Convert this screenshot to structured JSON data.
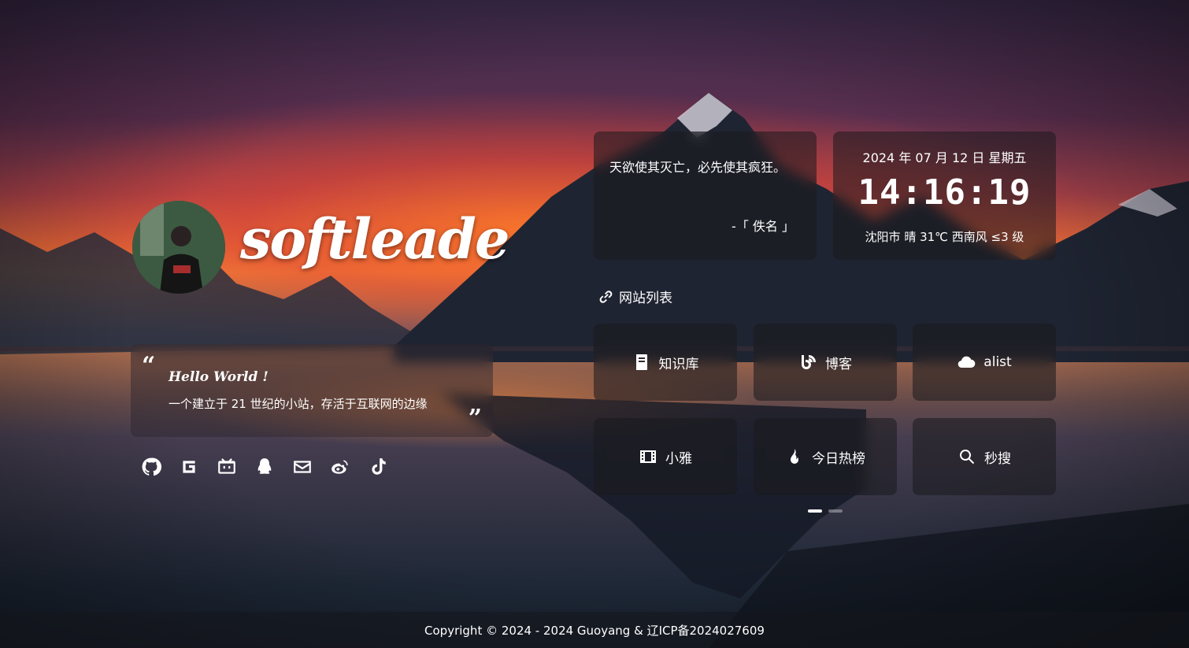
{
  "profile": {
    "site_name": "softleade",
    "greeting": "Hello World !",
    "intro": "一个建立于 21 世纪的小站，存活于互联网的边缘"
  },
  "socials": [
    {
      "icon": "github-icon"
    },
    {
      "icon": "g-icon"
    },
    {
      "icon": "bilibili-icon"
    },
    {
      "icon": "qq-icon"
    },
    {
      "icon": "mail-icon"
    },
    {
      "icon": "weibo-icon"
    },
    {
      "icon": "tiktok-icon"
    }
  ],
  "hitokoto": {
    "text": "天欲使其灭亡，必先使其疯狂。",
    "from": "-「 佚名 」"
  },
  "clock": {
    "date": "2024 年 07 月 12 日 星期五",
    "time": "14:16:19",
    "weather": "沈阳市 晴 31℃ 西南风 ≤3 级"
  },
  "sites": {
    "title": "网站列表",
    "items": [
      {
        "label": "知识库",
        "icon": "book-icon"
      },
      {
        "label": "博客",
        "icon": "blog-icon"
      },
      {
        "label": "alist",
        "icon": "cloud-icon"
      },
      {
        "label": "小雅",
        "icon": "film-icon"
      },
      {
        "label": "今日热榜",
        "icon": "fire-icon"
      },
      {
        "label": "秒搜",
        "icon": "search-icon"
      }
    ]
  },
  "pagination": {
    "current": 1,
    "total": 2
  },
  "footer": {
    "copyright": "Copyright © 2024 - 2024 Guoyang & 辽ICP备2024027609"
  }
}
